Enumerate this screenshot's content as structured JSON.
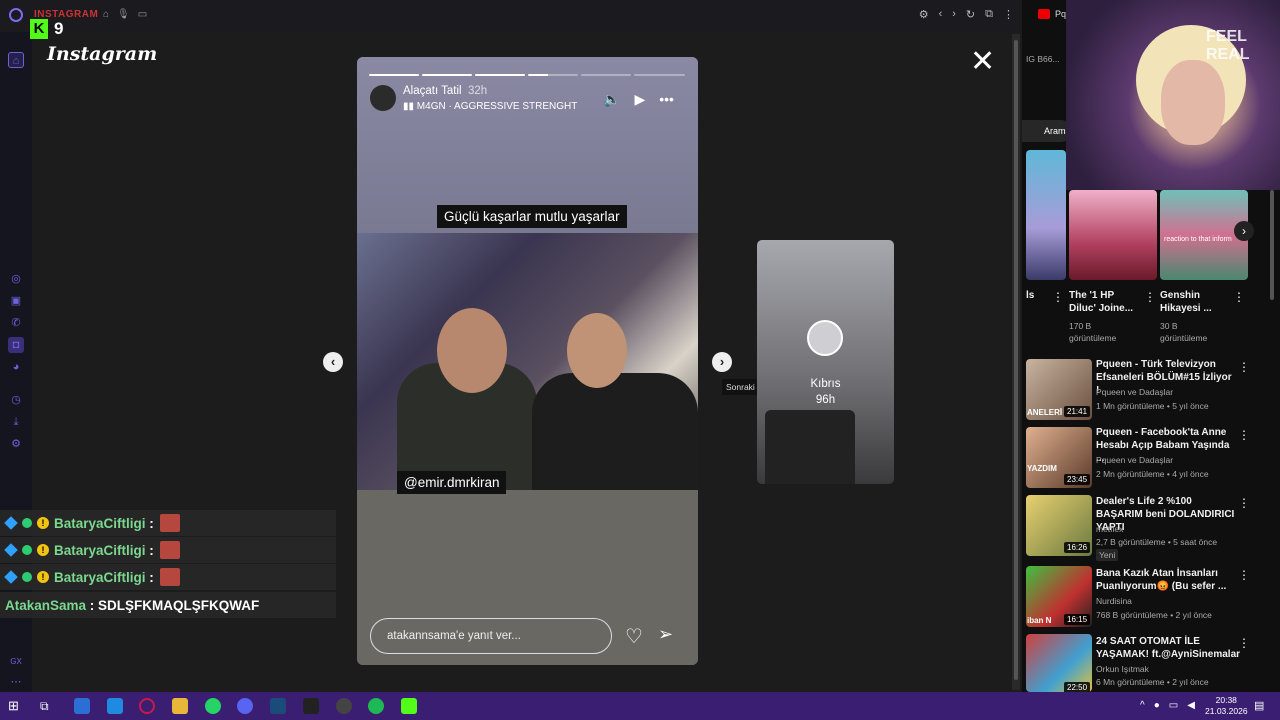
{
  "browser": {
    "tab_title": "INSTAGRAM",
    "side_tab_label": "Pq"
  },
  "kick": {
    "logo": "K",
    "count": "9"
  },
  "instagram": {
    "logo": "Instagram"
  },
  "story": {
    "username": "Alaçatı Tatil",
    "time": "32h",
    "music": "M4GN · AGGRESSIVE STRENGHT",
    "caption_top": "Güçlü kaşarlar mutlu yaşarlar",
    "caption_tag": "@emir.dmrkiran",
    "reply_placeholder": "atakannsama'e yanıt ver..."
  },
  "next_tooltip": "Sonraki",
  "next_preview": {
    "username": "Kıbrıs",
    "time": "96h"
  },
  "chat": [
    {
      "user": "BataryaCiftligi",
      "msg": ""
    },
    {
      "user": "BataryaCiftligi",
      "msg": ""
    },
    {
      "user": "BataryaCiftligi",
      "msg": ""
    },
    {
      "user": "AtakanSama",
      "msg": "SDLŞFKMAQLŞFKQWAF"
    }
  ],
  "youtube": {
    "top_text": "IG B66...",
    "search_label": "Araman",
    "shorts": [
      {
        "title": "ls",
        "views": ""
      },
      {
        "title": "The '1 HP Diluc' Joine...",
        "views": "170 B görüntüleme"
      },
      {
        "title": "Genshin Hikayesi ...",
        "views": "30 B görüntüleme"
      }
    ],
    "shorts_thumb_text": "reaction to that inform",
    "videos": [
      {
        "title": "Pqueen - Türk Televizyon Efsaneleri BÖLÜM#15 İzliyor !",
        "channel": "Pqueen ve Dadaşlar",
        "meta": "1 Mn görüntüleme • 5 yıl önce",
        "duration": "21:41",
        "thumb_text": "ANELERİ",
        "badge": ""
      },
      {
        "title": "Pqueen - Facebook'ta Anne Hesabı Açıp Babam Yaşında ...",
        "channel": "Pqueen ve Dadaşlar",
        "meta": "2 Mn görüntüleme • 4 yıl önce",
        "duration": "23:45",
        "thumb_text": "YAZDIM",
        "badge": ""
      },
      {
        "title": "Dealer's Life 2 %100 BAŞARIM beni DOLANDIRICI YAPTI",
        "channel": "metflex",
        "meta": "2,7 B görüntüleme • 5 saat önce",
        "duration": "16:26",
        "thumb_text": "",
        "badge": "Yeni"
      },
      {
        "title": "Bana Kazık Atan İnsanları Puanlıyorum😡 (Bu sefer ...",
        "channel": "Nurdisina",
        "meta": "768 B görüntüleme • 2 yıl önce",
        "duration": "16:15",
        "thumb_text": "iban N",
        "badge": ""
      },
      {
        "title": "24 SAAT OTOMAT İLE YAŞAMAK! ft.@AyniSinemalar",
        "channel": "Orkun Işıtmak",
        "meta": "6 Mn görüntüleme • 2 yıl önce",
        "duration": "22:50",
        "thumb_text": "",
        "badge": ""
      }
    ]
  },
  "webcam": {
    "sign_text": "FEEL REAL"
  },
  "taskbar": {
    "time": "20:38",
    "date": "21.03.2026"
  },
  "sidebar_bottom": "GX"
}
